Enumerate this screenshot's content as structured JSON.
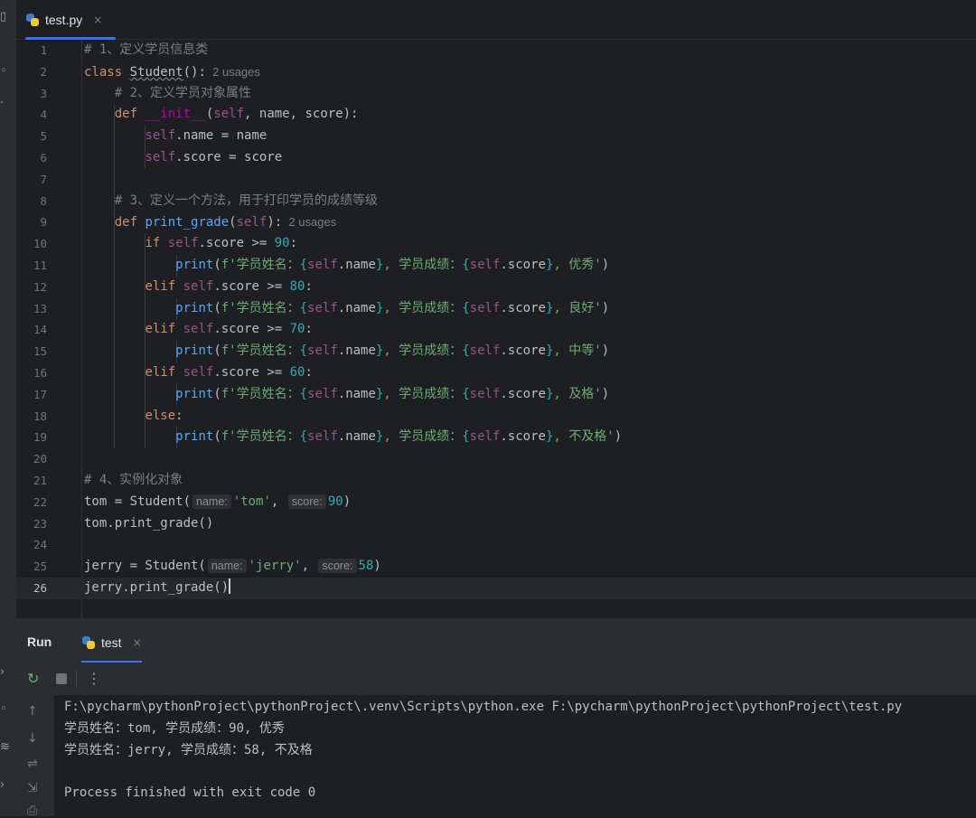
{
  "tab": {
    "file_name": "test.py",
    "close": "×"
  },
  "editor": {
    "line_numbers": [
      "1",
      "2",
      "3",
      "4",
      "5",
      "6",
      "7",
      "8",
      "9",
      "10",
      "11",
      "12",
      "13",
      "14",
      "15",
      "16",
      "17",
      "18",
      "19",
      "20",
      "21",
      "22",
      "23",
      "24",
      "25",
      "26"
    ],
    "current_line": 26,
    "hints": {
      "usages_student": "2 usages",
      "usages_print_grade": "2 usages",
      "name": "name:",
      "score": "score:"
    },
    "lines": [
      "# 1、定义学员信息类",
      "class Student():",
      "    # 2、定义学员对象属性",
      "    def __init__(self, name, score):",
      "        self.name = name",
      "        self.score = score",
      "",
      "    # 3、定义一个方法，用于打印学员的成绩等级",
      "    def print_grade(self):",
      "        if self.score >= 90:",
      "            print(f'学员姓名：{self.name}, 学员成绩：{self.score}, 优秀')",
      "        elif self.score >= 80:",
      "            print(f'学员姓名：{self.name}, 学员成绩：{self.score}, 良好')",
      "        elif self.score >= 70:",
      "            print(f'学员姓名：{self.name}, 学员成绩：{self.score}, 中等')",
      "        elif self.score >= 60:",
      "            print(f'学员姓名：{self.name}, 学员成绩：{self.score}, 及格')",
      "        else:",
      "            print(f'学员姓名：{self.name}, 学员成绩：{self.score}, 不及格')",
      "",
      "# 4、实例化对象",
      "tom = Student('tom', 90)",
      "tom.print_grade()",
      "",
      "jerry = Student('jerry', 58)",
      "jerry.print_grade()"
    ]
  },
  "run_panel": {
    "title": "Run",
    "tab_label": "test",
    "tab_close": "×",
    "tools": {
      "rerun": "↻",
      "more": "⋮",
      "up": "↑",
      "down": "↓",
      "soft_wrap": "⇌",
      "scroll_end": "⇲",
      "print": "⎙"
    },
    "output": [
      "F:\\pycharm\\pythonProject\\pythonProject\\.venv\\Scripts\\python.exe F:\\pycharm\\pythonProject\\pythonProject\\test.py",
      "学员姓名：tom, 学员成绩：90, 优秀",
      "学员姓名：jerry, 学员成绩：58, 不及格",
      "",
      "Process finished with exit code 0"
    ]
  },
  "colors": {
    "background": "#1e1f22",
    "panel": "#2b2d30",
    "keyword": "#cf8e6d",
    "string": "#6aab73",
    "number": "#2aacb8",
    "comment": "#7a7e85",
    "self": "#94558d",
    "function": "#56a8f5",
    "dunder": "#b200b2",
    "accent": "#3574f0"
  }
}
